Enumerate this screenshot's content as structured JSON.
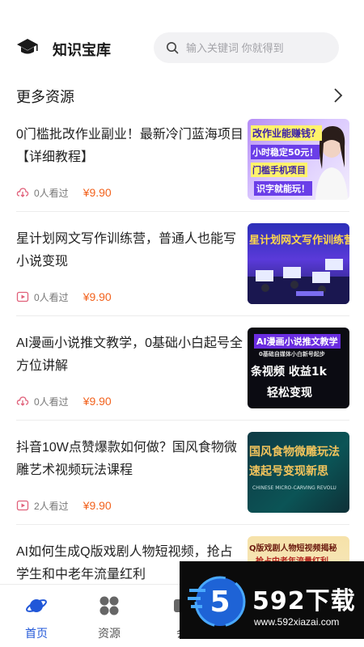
{
  "header": {
    "title": "知识宝库",
    "search_placeholder": "输入关键词 你就得到"
  },
  "section": {
    "title": "更多资源"
  },
  "items": [
    {
      "title": "0门槛批改作业副业！最新冷门蓝海项目【详细教程】",
      "views": "0人看过",
      "price": "¥9.90",
      "meta_icon": "cloud-download-icon",
      "thumb_lines": [
        "改作业能赚钱？",
        "小时稳定50元！",
        "门槛手机项目",
        "识字就能玩！"
      ]
    },
    {
      "title": "星计划网文写作训练营，普通人也能写小说变现",
      "views": "0人看过",
      "price": "¥9.90",
      "meta_icon": "play-icon",
      "thumb_lines": [
        "星计划网文写作训练营"
      ]
    },
    {
      "title": "AI漫画小说推文教学，0基础小白起号全方位讲解",
      "views": "0人看过",
      "price": "¥9.90",
      "meta_icon": "cloud-download-icon",
      "thumb_lines": [
        "AI漫画小说推文教学",
        "0基础自媒体小白新号起步",
        "条视频 收益1k",
        "轻松变现"
      ]
    },
    {
      "title": "抖音10W点赞爆款如何做？国风食物微雕艺术视频玩法课程",
      "views": "2人看过",
      "price": "¥9.90",
      "meta_icon": "play-icon",
      "thumb_lines": [
        "国风食物微雕玩法",
        "速起号变现新思",
        "CHINESE MICRO-CARVING REVOLU"
      ]
    },
    {
      "title": "AI如何生成Q版戏剧人物短视频，抢占学生和中老年流量红利",
      "views": "",
      "price": "",
      "meta_icon": "",
      "thumb_lines": [
        "Q版戏剧人物短视频揭秘",
        "抢占中老年流量红利"
      ]
    }
  ],
  "tabs": [
    {
      "label": "首页",
      "icon": "planet-icon",
      "active": true
    },
    {
      "label": "资源",
      "icon": "grid-icon",
      "active": false
    },
    {
      "label": "会",
      "icon": "member-icon",
      "active": false
    }
  ],
  "watermark": {
    "badge": "5",
    "brand": "592下载",
    "url": "www.592xiazai.com"
  },
  "colors": {
    "accent": "#2157d8",
    "price": "#f2621d"
  }
}
